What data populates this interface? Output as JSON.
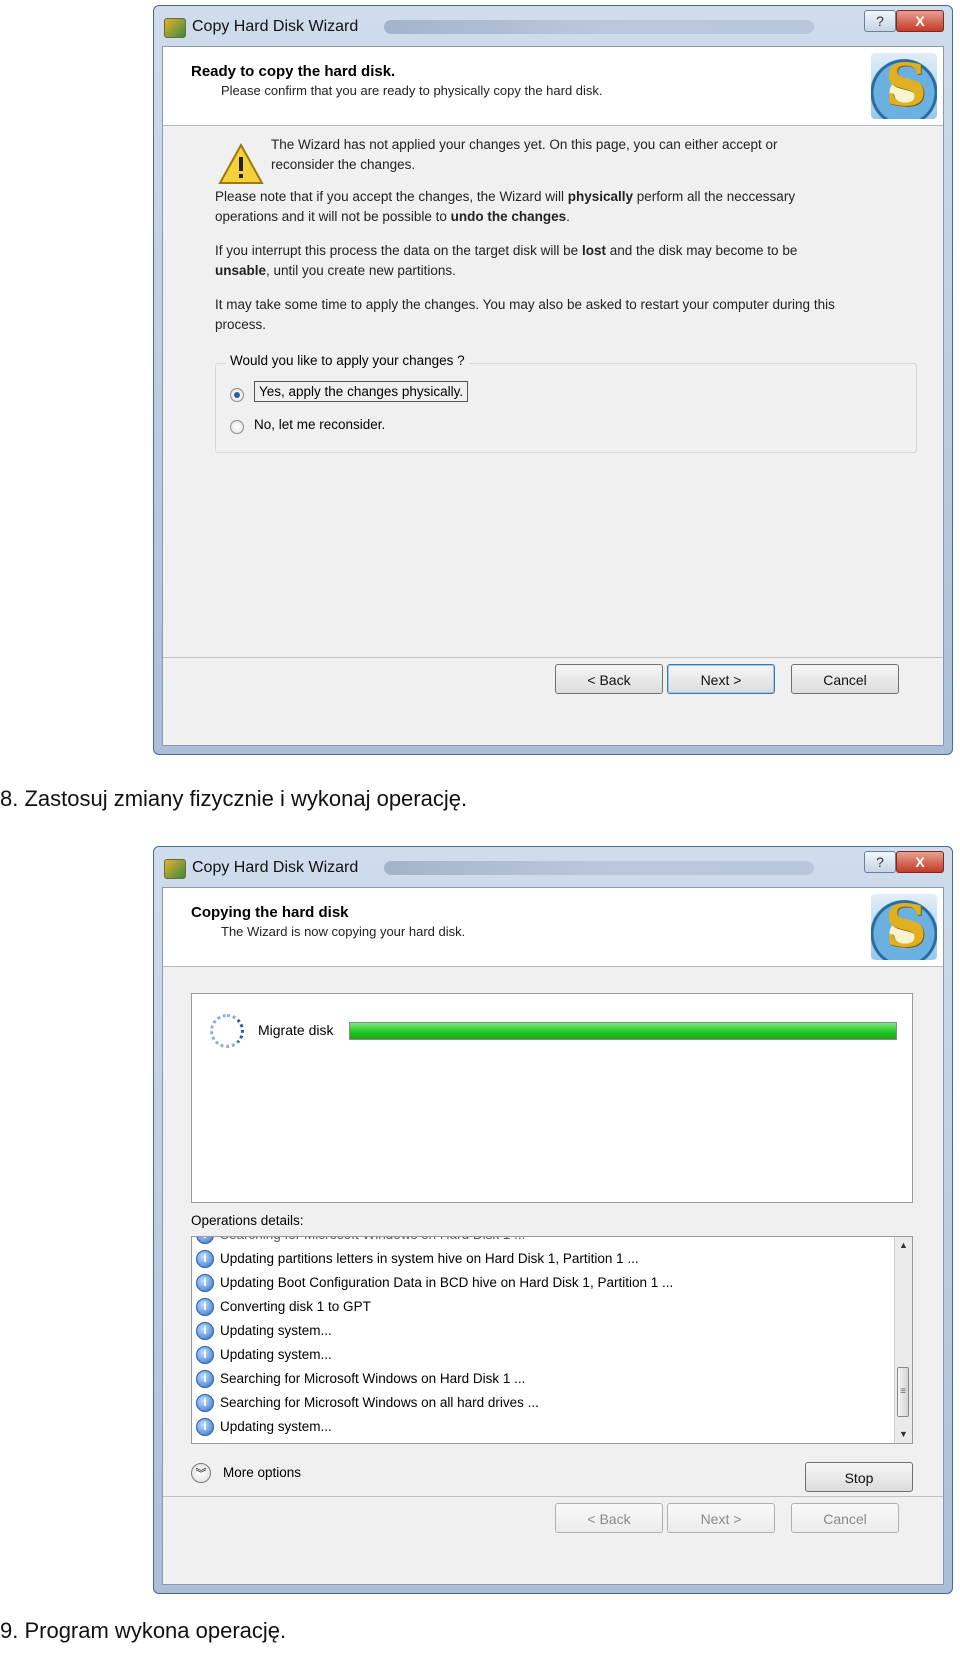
{
  "window1": {
    "title": "Copy Hard Disk Wizard",
    "help_btn": "?",
    "close_btn": "X",
    "header_title": "Ready to copy the hard disk.",
    "header_sub": "Please confirm that you are ready to physically copy the hard disk.",
    "warning_text": "The Wizard has not applied your changes yet. On this page, you can either accept or reconsider the changes.",
    "note_pre": "Please note that if you accept the changes, the Wizard will ",
    "note_bold1": "physically",
    "note_mid": " perform all the neccessary operations and it will not be possible to ",
    "note_bold2": "undo the changes",
    "note_end": ".",
    "interrupt_pre": "If you interrupt this process the data on the target disk will be ",
    "interrupt_bold1": "lost",
    "interrupt_mid": " and the disk may become to be ",
    "interrupt_bold2": "unsable",
    "interrupt_end": ", until you create new partitions.",
    "time_text": "It may take some time to apply the changes. You may also be asked to restart your computer during this process.",
    "question": "Would you like to apply your changes ?",
    "option_yes": "Yes, apply the changes physically.",
    "option_no": "No, let me reconsider.",
    "back": "< Back",
    "next": "Next >",
    "cancel": "Cancel"
  },
  "caption1": "8. Zastosuj zmiany fizycznie i wykonaj operację.",
  "window2": {
    "title": "Copy Hard Disk Wizard",
    "help_btn": "?",
    "close_btn": "X",
    "header_title": "Copying the hard disk",
    "header_sub": "The Wizard is now copying your hard disk.",
    "task_label": "Migrate disk",
    "progress": 1.0,
    "ops_label": "Operations details:",
    "operations": [
      "Updating partitions letters in system hive on Hard Disk 1, Partition 1 ...",
      "Updating Boot Configuration Data in BCD hive on Hard Disk 1, Partition 1 ...",
      "Converting disk 1 to GPT",
      "Updating system...",
      "Updating system...",
      "Searching for Microsoft Windows on Hard Disk 1 ...",
      "Searching for Microsoft Windows on all hard drives ...",
      "Updating system..."
    ],
    "more_options": "More options",
    "stop": "Stop",
    "back": "< Back",
    "next": "Next >",
    "cancel": "Cancel"
  },
  "caption2": "9. Program wykona operację.",
  "icons": {
    "warning": "warning-icon",
    "info": "info-icon",
    "spinner": "spinner-icon",
    "logo": "app-logo"
  }
}
